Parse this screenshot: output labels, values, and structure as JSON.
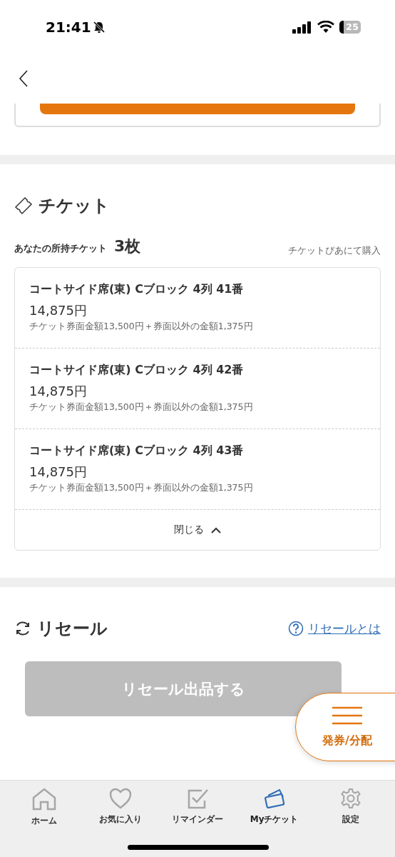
{
  "status_bar": {
    "time": "21:41",
    "battery": "25"
  },
  "tickets": {
    "title": "チケット",
    "owned_label": "あなたの所持チケット",
    "owned_count": "3枚",
    "buy_link": "チケットぴあにて購入",
    "items": [
      {
        "seat": "コートサイド席(東) Cブロック 4列 41番",
        "price": "14,875円",
        "breakdown": "チケット券面金額13,500円＋券面以外の金額1,375円"
      },
      {
        "seat": "コートサイド席(東) Cブロック 4列 42番",
        "price": "14,875円",
        "breakdown": "チケット券面金額13,500円＋券面以外の金額1,375円"
      },
      {
        "seat": "コートサイド席(東) Cブロック 4列 43番",
        "price": "14,875円",
        "breakdown": "チケット券面金額13,500円＋券面以外の金額1,375円"
      }
    ],
    "close_label": "閉じる",
    "expanded": true
  },
  "resale": {
    "title": "リセール",
    "help_link": "リセールとは",
    "button": "リセール出品する",
    "button_disabled": true
  },
  "floating_button": {
    "label": "発券/分配"
  },
  "tab_bar": [
    {
      "label": "ホーム",
      "kind": "home",
      "selected": false
    },
    {
      "label": "お気に入り",
      "kind": "favorite",
      "selected": false
    },
    {
      "label": "リマインダー",
      "kind": "reminder",
      "selected": false
    },
    {
      "label": "Myチケット",
      "kind": "ticket",
      "selected": true
    },
    {
      "label": "設定",
      "kind": "settings",
      "selected": false
    }
  ]
}
